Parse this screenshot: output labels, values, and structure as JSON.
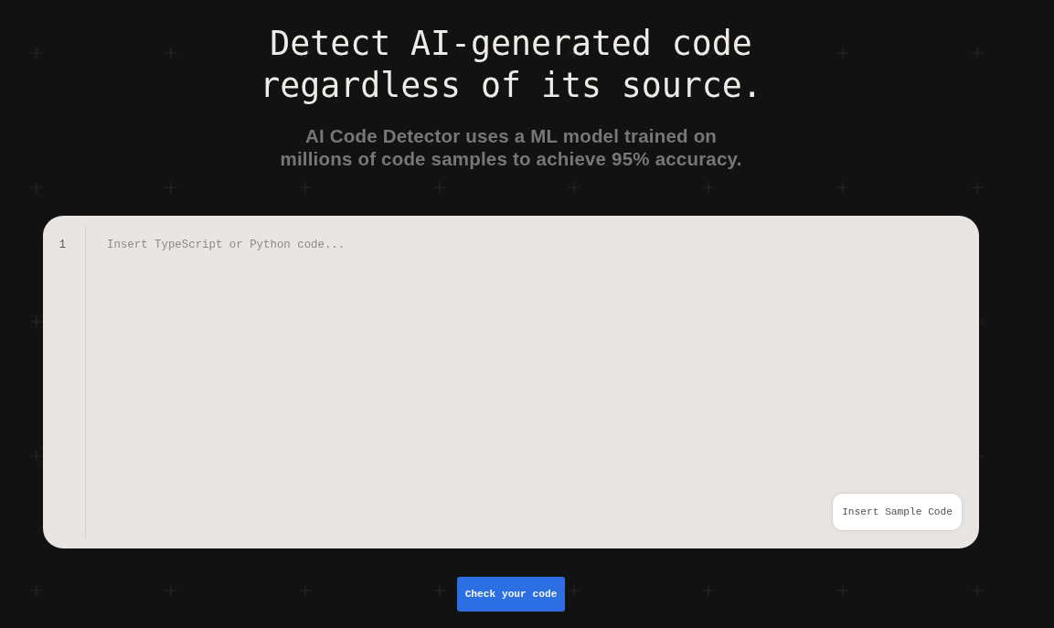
{
  "hero": {
    "title": "Detect AI-generated code regardless of its source.",
    "subtitle": "AI Code Detector uses a ML model trained on millions of code samples to achieve 95% accuracy."
  },
  "editor": {
    "line_numbers": [
      "1"
    ],
    "placeholder": "Insert TypeScript or Python code...",
    "sample_button": "Insert Sample Code"
  },
  "submit_button": "Check your code"
}
